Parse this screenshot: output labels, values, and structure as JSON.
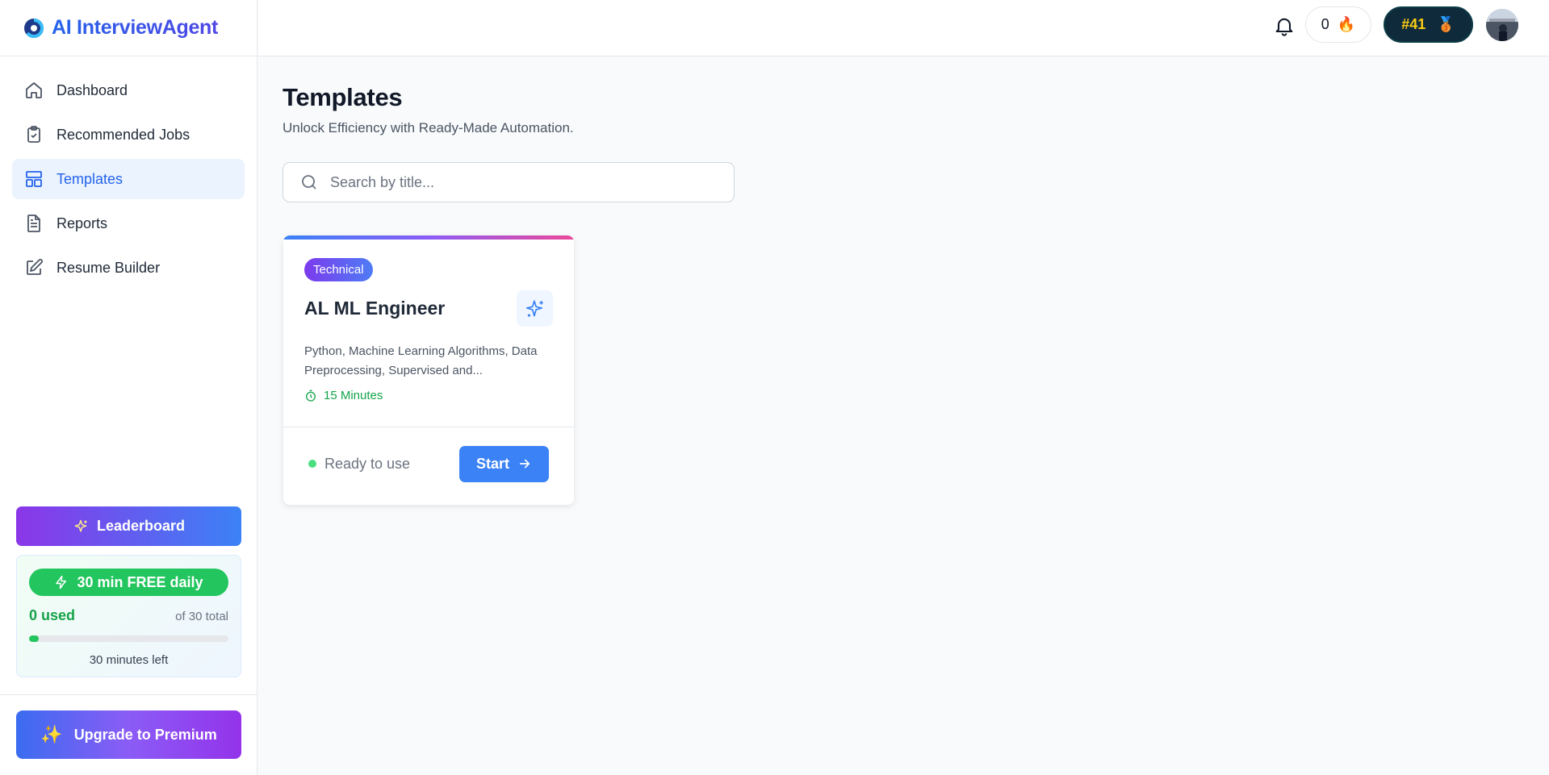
{
  "brand": {
    "name": "AI InterviewAgent",
    "logo_icon": "swirl-logo-icon"
  },
  "sidebar": {
    "items": [
      {
        "label": "Dashboard",
        "icon": "home-icon",
        "active": false
      },
      {
        "label": "Recommended Jobs",
        "icon": "clipboard-check-icon",
        "active": false
      },
      {
        "label": "Templates",
        "icon": "layout-icon",
        "active": true
      },
      {
        "label": "Reports",
        "icon": "document-icon",
        "active": false
      },
      {
        "label": "Resume Builder",
        "icon": "edit-icon",
        "active": false
      }
    ],
    "leaderboard_label": "Leaderboard",
    "usage": {
      "free_label": "30 min FREE daily",
      "used_label": "0 used",
      "total_label": "of 30 total",
      "used_fraction": 0,
      "left_label": "30 minutes left"
    },
    "premium_label": "Upgrade to Premium"
  },
  "header": {
    "streak_count": "0",
    "streak_icon": "🔥",
    "rank_label": "#41",
    "rank_icon": "🥉"
  },
  "main": {
    "title": "Templates",
    "subtitle": "Unlock Efficiency with Ready-Made Automation.",
    "search_placeholder": "Search by title...",
    "templates": [
      {
        "tag": "Technical",
        "title": "AL ML Engineer",
        "description": "Python, Machine Learning Algorithms, Data Preprocessing, Supervised and...",
        "duration": "15 Minutes",
        "status": "Ready to use",
        "action": "Start"
      }
    ]
  },
  "colors": {
    "accent": "#3b82f6",
    "active_bg": "#eaf3fe",
    "green": "#22c55e",
    "purple": "#8b36e8"
  }
}
